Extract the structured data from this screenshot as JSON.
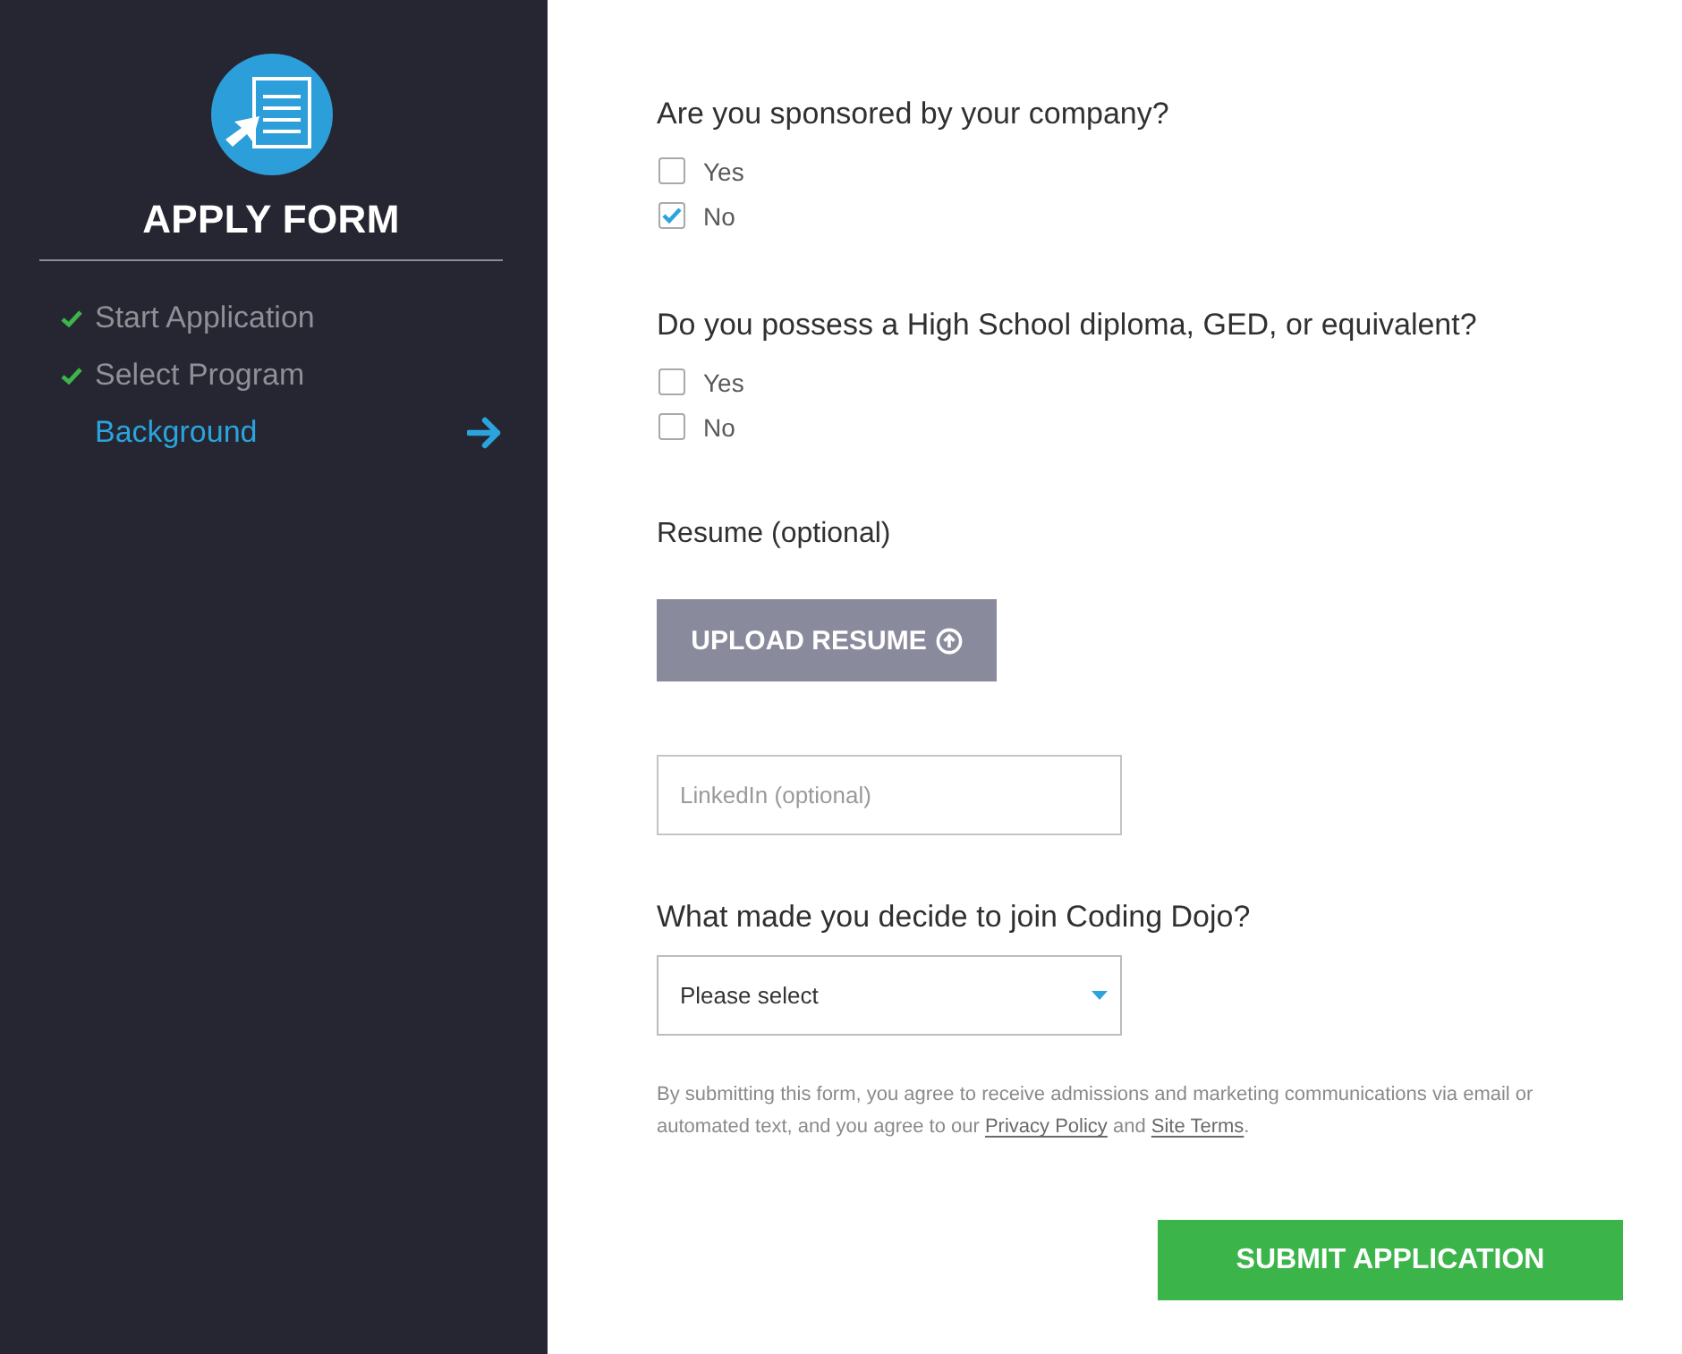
{
  "sidebar": {
    "title": "APPLY FORM",
    "steps": [
      {
        "label": "Start Application",
        "completed": true,
        "selected": false
      },
      {
        "label": "Select Program",
        "completed": true,
        "selected": false
      },
      {
        "label": "Background",
        "completed": false,
        "selected": true
      }
    ]
  },
  "questions": [
    {
      "label": "Are you sponsored by your company?",
      "options": [
        {
          "label": "Yes",
          "checked": false
        },
        {
          "label": "No",
          "checked": true
        }
      ]
    },
    {
      "label": "Do you possess a High School diploma, GED, or equivalent?",
      "options": [
        {
          "label": "Yes",
          "checked": false
        },
        {
          "label": "No",
          "checked": false
        }
      ]
    }
  ],
  "resume": {
    "label": "Resume (optional)",
    "button": "UPLOAD RESUME"
  },
  "linkedin": {
    "placeholder": "LinkedIn (optional)"
  },
  "referral": {
    "label": "What made you decide to join Coding Dojo?",
    "value": "Please select"
  },
  "disclaimer": [
    {
      "kind": "text",
      "text": "By submitting this form, you agree to receive admissions and marketing communications via email or automated text, and you agree to our "
    },
    {
      "kind": "link",
      "text": "Privacy Policy"
    },
    {
      "kind": "text",
      "text": " and "
    },
    {
      "kind": "link",
      "text": "Site Terms"
    },
    {
      "kind": "text",
      "text": "."
    }
  ],
  "submit": {
    "label": "SUBMIT APPLICATION"
  }
}
